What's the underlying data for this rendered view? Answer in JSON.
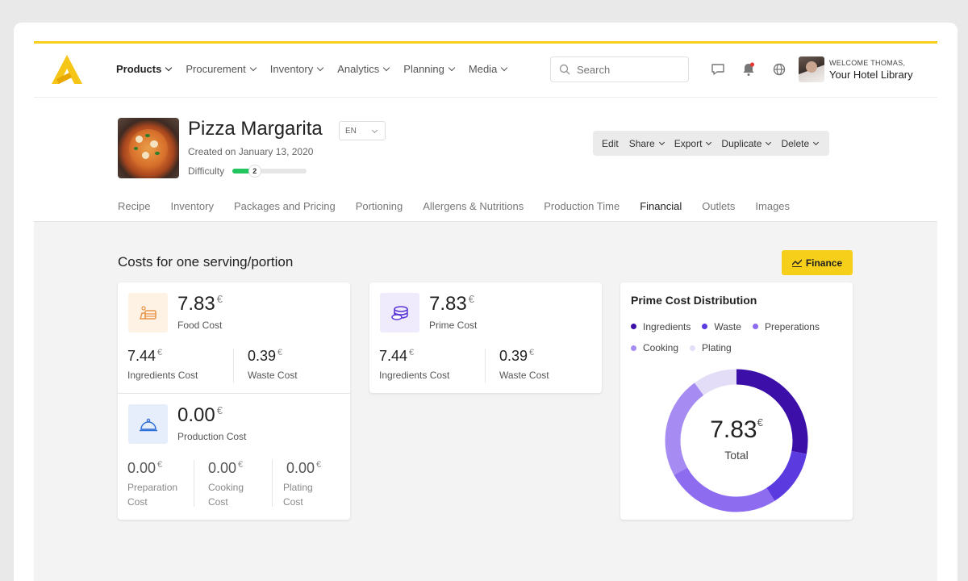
{
  "nav": {
    "items": [
      "Products",
      "Procurement",
      "Inventory",
      "Analytics",
      "Planning",
      "Media"
    ],
    "search_placeholder": "Search",
    "welcome": "WELCOME THOMAS,",
    "hotel": "Your Hotel Library"
  },
  "product": {
    "title": "Pizza Margarita",
    "language": "EN",
    "created": "Created on January 13, 2020",
    "difficulty_label": "Difficulty",
    "difficulty_value": "2",
    "difficulty_fraction": 0.3
  },
  "actions": [
    "Edit",
    "Share",
    "Export",
    "Duplicate",
    "Delete"
  ],
  "tabs": [
    "Recipe",
    "Inventory",
    "Packages and Pricing",
    "Portioning",
    "Allergens & Nutritions",
    "Production Time",
    "Financial",
    "Outlets",
    "Images"
  ],
  "active_tab": "Financial",
  "section_title": "Costs for one serving/portion",
  "finance_button": "Finance",
  "currency": "€",
  "food_cost": {
    "value": "7.83",
    "label": "Food Cost",
    "ingredients_value": "7.44",
    "ingredients_label": "Ingredients Cost",
    "waste_value": "0.39",
    "waste_label": "Waste Cost"
  },
  "production_cost": {
    "value": "0.00",
    "label": "Production Cost",
    "preparation_value": "0.00",
    "preparation_label_1": "Preparation",
    "preparation_label_2": "Cost",
    "cooking_value": "0.00",
    "cooking_label_1": "Cooking",
    "cooking_label_2": "Cost",
    "plating_value": "0.00",
    "plating_label_1": "Plating",
    "plating_label_2": "Cost"
  },
  "prime_cost": {
    "value": "7.83",
    "label": "Prime Cost",
    "ingredients_value": "7.44",
    "ingredients_label": "Ingredients Cost",
    "waste_value": "0.39",
    "waste_label": "Waste Cost"
  },
  "chart_data": {
    "type": "pie",
    "title": "Prime Cost Distribution",
    "center_value": "7.83",
    "center_label": "Total",
    "series": [
      {
        "name": "Ingredients",
        "value": 0.28,
        "color": "#3b0fa8"
      },
      {
        "name": "Waste",
        "value": 0.13,
        "color": "#5b3be0"
      },
      {
        "name": "Preperations",
        "value": 0.26,
        "color": "#8d6cf0"
      },
      {
        "name": "Cooking",
        "value": 0.23,
        "color": "#a68cf2"
      },
      {
        "name": "Plating",
        "value": 0.1,
        "color": "#e4ddf8"
      }
    ]
  },
  "colors": {
    "accent": "#f5cf1a",
    "success": "#22c55e"
  }
}
